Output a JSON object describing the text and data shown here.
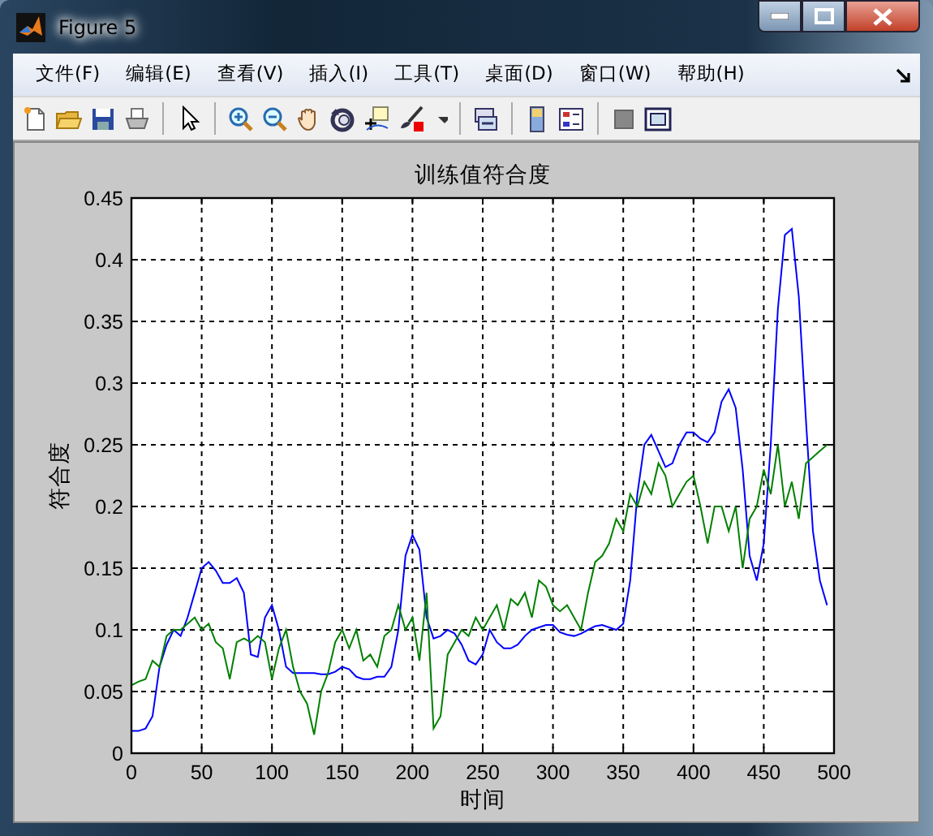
{
  "window": {
    "title": "Figure 5"
  },
  "menu": [
    "文件(F)",
    "编辑(E)",
    "查看(V)",
    "插入(I)",
    "工具(T)",
    "桌面(D)",
    "窗口(W)",
    "帮助(H)"
  ],
  "figure": {
    "chart_data": {
      "type": "line",
      "title": "训练值符合度",
      "xlabel": "时间",
      "ylabel": "符合度",
      "x": [
        0,
        5,
        10,
        15,
        20,
        25,
        30,
        35,
        40,
        45,
        50,
        55,
        60,
        65,
        70,
        75,
        80,
        85,
        90,
        95,
        100,
        105,
        110,
        115,
        120,
        125,
        130,
        135,
        140,
        145,
        150,
        155,
        160,
        165,
        170,
        175,
        180,
        185,
        190,
        195,
        200,
        205,
        210,
        215,
        220,
        225,
        230,
        235,
        240,
        245,
        250,
        255,
        260,
        265,
        270,
        275,
        280,
        285,
        290,
        295,
        300,
        305,
        310,
        315,
        320,
        325,
        330,
        335,
        340,
        345,
        350,
        355,
        360,
        365,
        370,
        375,
        380,
        385,
        390,
        395,
        400,
        405,
        410,
        415,
        420,
        425,
        430,
        435,
        440,
        445,
        450,
        455,
        460,
        465,
        470,
        475,
        480,
        485,
        490,
        495
      ],
      "series": [
        {
          "color": "#0000ff",
          "values": [
            0.018,
            0.018,
            0.02,
            0.03,
            0.07,
            0.088,
            0.1,
            0.095,
            0.11,
            0.13,
            0.15,
            0.155,
            0.148,
            0.138,
            0.138,
            0.142,
            0.13,
            0.08,
            0.078,
            0.11,
            0.12,
            0.1,
            0.07,
            0.065,
            0.065,
            0.065,
            0.065,
            0.064,
            0.064,
            0.066,
            0.07,
            0.068,
            0.062,
            0.06,
            0.06,
            0.062,
            0.062,
            0.07,
            0.1,
            0.16,
            0.177,
            0.165,
            0.11,
            0.093,
            0.095,
            0.1,
            0.097,
            0.088,
            0.075,
            0.072,
            0.08,
            0.1,
            0.09,
            0.085,
            0.085,
            0.088,
            0.095,
            0.1,
            0.102,
            0.104,
            0.104,
            0.098,
            0.096,
            0.095,
            0.097,
            0.1,
            0.103,
            0.104,
            0.102,
            0.1,
            0.105,
            0.14,
            0.21,
            0.25,
            0.258,
            0.245,
            0.232,
            0.235,
            0.25,
            0.26,
            0.26,
            0.255,
            0.252,
            0.26,
            0.285,
            0.295,
            0.28,
            0.23,
            0.16,
            0.14,
            0.17,
            0.25,
            0.36,
            0.42,
            0.425,
            0.37,
            0.27,
            0.18,
            0.14,
            0.12
          ]
        },
        {
          "color": "#008000",
          "values": [
            0.055,
            0.058,
            0.06,
            0.075,
            0.07,
            0.095,
            0.1,
            0.1,
            0.105,
            0.11,
            0.1,
            0.105,
            0.09,
            0.085,
            0.06,
            0.09,
            0.093,
            0.09,
            0.095,
            0.09,
            0.06,
            0.085,
            0.1,
            0.07,
            0.05,
            0.04,
            0.015,
            0.05,
            0.065,
            0.09,
            0.1,
            0.085,
            0.1,
            0.075,
            0.08,
            0.07,
            0.095,
            0.1,
            0.12,
            0.1,
            0.11,
            0.075,
            0.13,
            0.02,
            0.03,
            0.08,
            0.09,
            0.1,
            0.095,
            0.11,
            0.1,
            0.11,
            0.12,
            0.1,
            0.125,
            0.12,
            0.13,
            0.11,
            0.14,
            0.135,
            0.12,
            0.115,
            0.12,
            0.11,
            0.1,
            0.13,
            0.155,
            0.16,
            0.17,
            0.19,
            0.18,
            0.21,
            0.2,
            0.22,
            0.21,
            0.235,
            0.225,
            0.2,
            0.21,
            0.22,
            0.225,
            0.2,
            0.17,
            0.2,
            0.2,
            0.18,
            0.2,
            0.15,
            0.19,
            0.2,
            0.23,
            0.21,
            0.25,
            0.2,
            0.22,
            0.19,
            0.235,
            0.24,
            0.245,
            0.25
          ]
        }
      ],
      "xlim": [
        0,
        500
      ],
      "ylim": [
        0,
        0.45
      ],
      "xticks": [
        0,
        50,
        100,
        150,
        200,
        250,
        300,
        350,
        400,
        450,
        500
      ],
      "yticks": [
        0,
        0.05,
        0.1,
        0.15,
        0.2,
        0.25,
        0.3,
        0.35,
        0.4,
        0.45
      ],
      "grid": true
    }
  }
}
